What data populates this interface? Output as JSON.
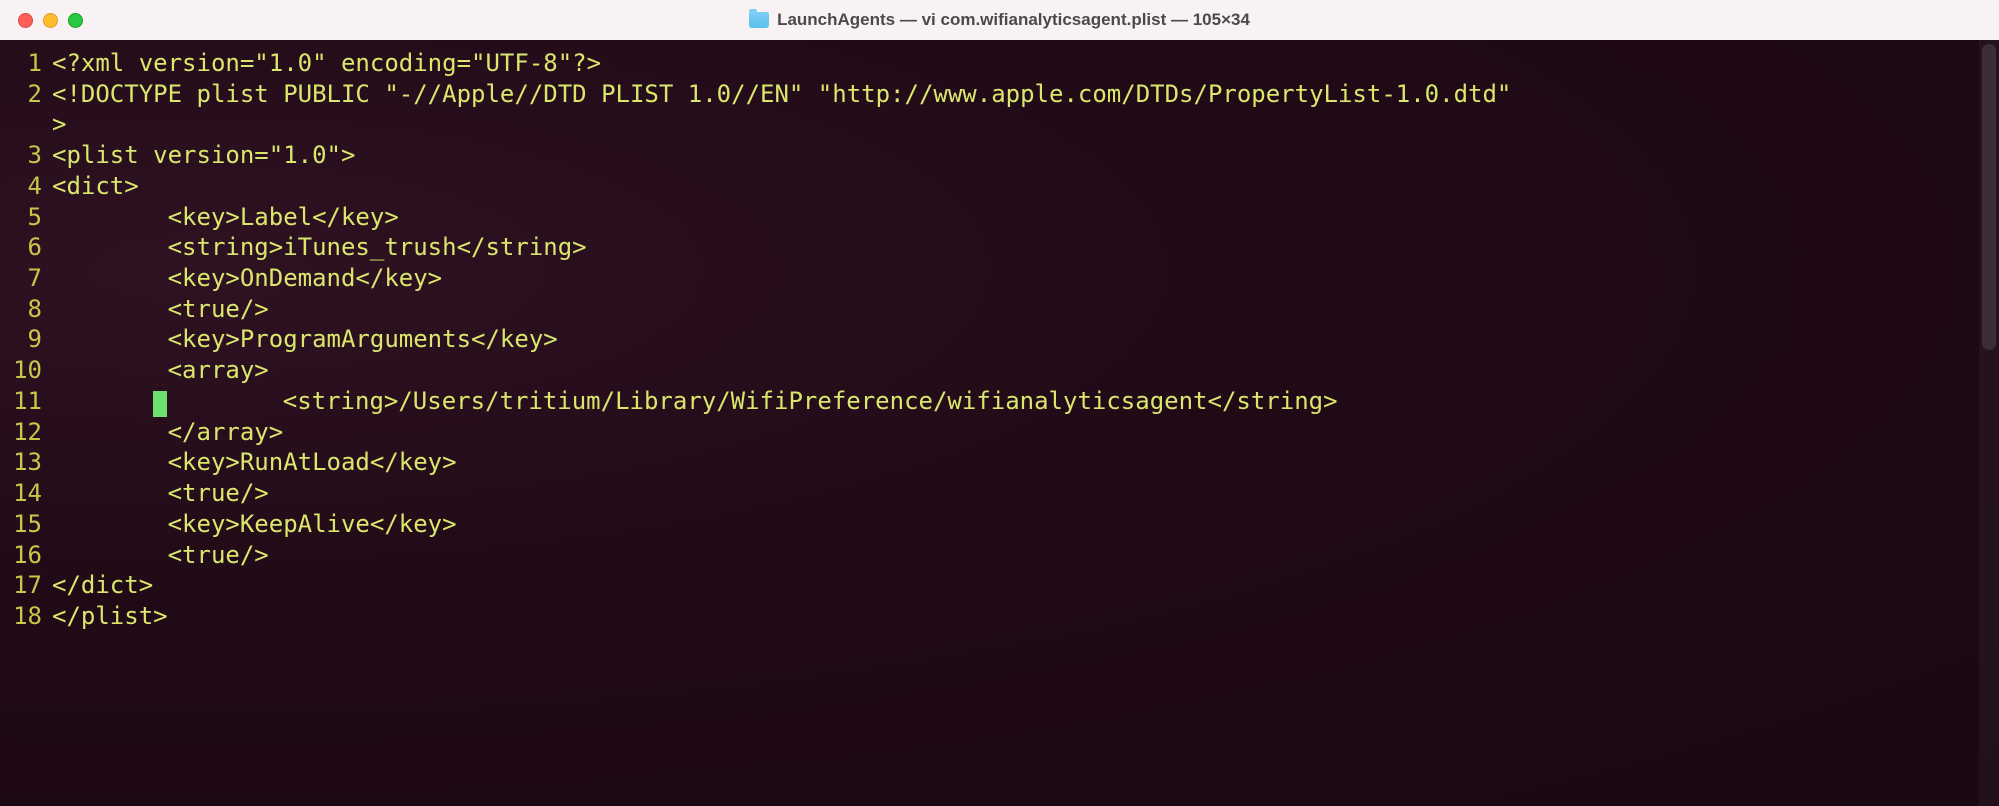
{
  "titlebar": {
    "title": "LaunchAgents — vi com.wifianalyticsagent.plist — 105×34",
    "folderIconName": "folder-icon"
  },
  "terminal": {
    "cursorLine": 11,
    "lines": [
      {
        "n": "1",
        "indent": "",
        "text": "<?xml version=\"1.0\" encoding=\"UTF-8\"?>"
      },
      {
        "n": "2",
        "indent": "",
        "text": "<!DOCTYPE plist PUBLIC \"-//Apple//DTD PLIST 1.0//EN\" \"http://www.apple.com/DTDs/PropertyList-1.0.dtd\""
      },
      {
        "n": "",
        "indent": "",
        "text": ">"
      },
      {
        "n": "3",
        "indent": "",
        "text": "<plist version=\"1.0\">"
      },
      {
        "n": "4",
        "indent": "",
        "text": "<dict>"
      },
      {
        "n": "5",
        "indent": "        ",
        "text": "<key>Label</key>"
      },
      {
        "n": "6",
        "indent": "        ",
        "text": "<string>iTunes_trush</string>"
      },
      {
        "n": "7",
        "indent": "        ",
        "text": "<key>OnDemand</key>"
      },
      {
        "n": "8",
        "indent": "        ",
        "text": "<true/>"
      },
      {
        "n": "9",
        "indent": "        ",
        "text": "<key>ProgramArguments</key>"
      },
      {
        "n": "10",
        "indent": "        ",
        "text": "<array>"
      },
      {
        "n": "11",
        "indent": "       ",
        "text": "        <string>/Users/tritium/Library/WifiPreference/wifianalyticsagent</string>",
        "cursor": true
      },
      {
        "n": "12",
        "indent": "        ",
        "text": "</array>"
      },
      {
        "n": "13",
        "indent": "        ",
        "text": "<key>RunAtLoad</key>"
      },
      {
        "n": "14",
        "indent": "        ",
        "text": "<true/>"
      },
      {
        "n": "15",
        "indent": "        ",
        "text": "<key>KeepAlive</key>"
      },
      {
        "n": "16",
        "indent": "        ",
        "text": "<true/>"
      },
      {
        "n": "17",
        "indent": "",
        "text": "</dict>"
      },
      {
        "n": "18",
        "indent": "",
        "text": "</plist>"
      }
    ]
  }
}
